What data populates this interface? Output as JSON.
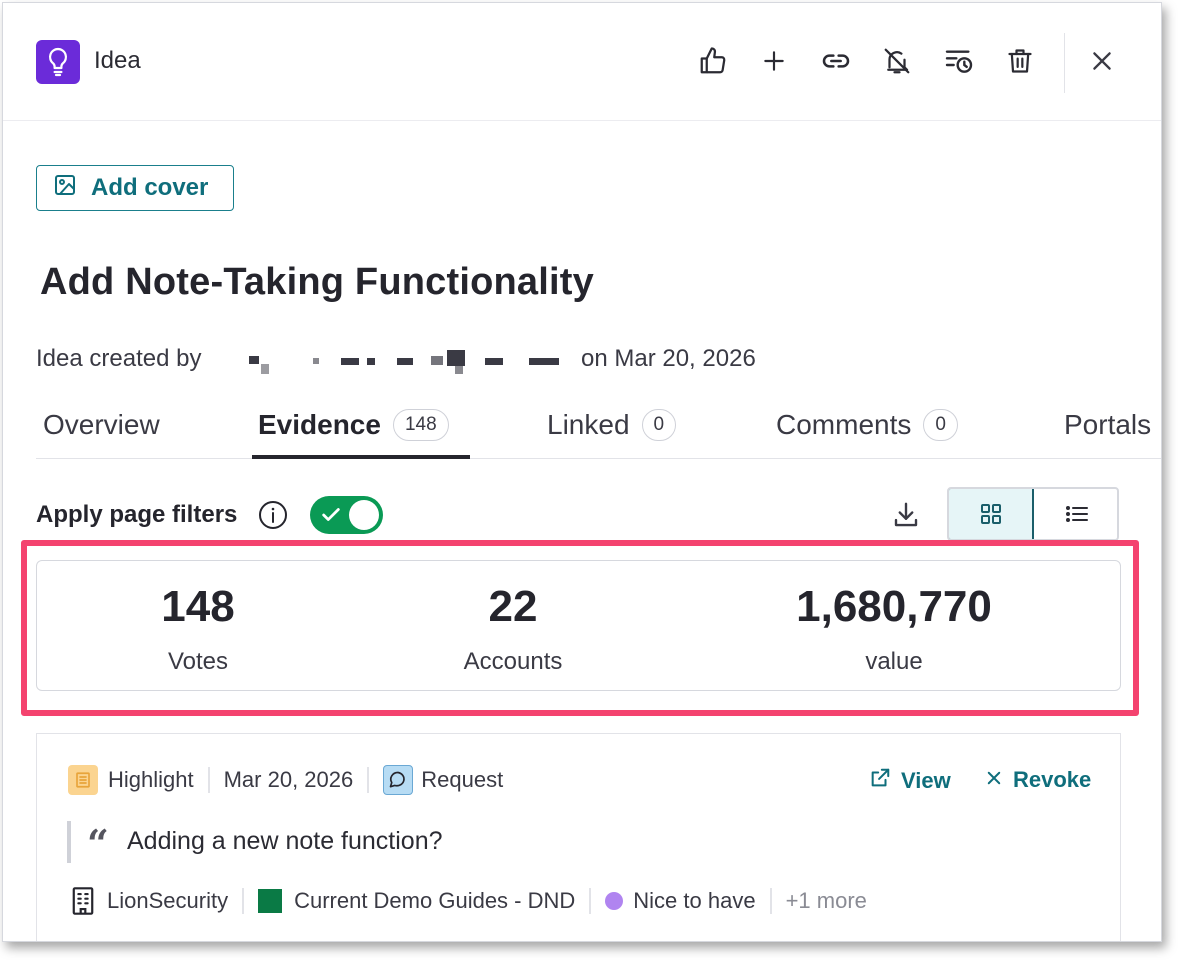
{
  "header": {
    "type_label": "Idea",
    "actions": [
      "thumbs-up-icon",
      "plus-icon",
      "link-icon",
      "bell-off-icon",
      "history-icon",
      "trash-icon",
      "close-icon"
    ]
  },
  "cover": {
    "label": "Add cover"
  },
  "idea": {
    "title": "Add Note-Taking Functionality",
    "created_prefix": "Idea created by",
    "created_suffix": "on Mar 20, 2026"
  },
  "tabs": [
    {
      "label": "Overview",
      "count": ""
    },
    {
      "label": "Evidence",
      "count": "148"
    },
    {
      "label": "Linked",
      "count": "0"
    },
    {
      "label": "Comments",
      "count": "0"
    },
    {
      "label": "Portals",
      "count": ""
    }
  ],
  "active_tab": "Evidence",
  "filters": {
    "label": "Apply page filters",
    "enabled": true
  },
  "stats": [
    {
      "value": "148",
      "label": "Votes"
    },
    {
      "value": "22",
      "label": "Accounts"
    },
    {
      "value": "1,680,770",
      "label": "value"
    }
  ],
  "evidence": {
    "type": "Highlight",
    "date": "Mar 20, 2026",
    "category": "Request",
    "view_label": "View",
    "revoke_label": "Revoke",
    "quote": "Adding a new note function?",
    "account": "LionSecurity",
    "guide": "Current Demo Guides - DND",
    "priority": "Nice to have",
    "more": "+1 more"
  },
  "colors": {
    "accent": "#0f6e7c",
    "idea_badge": "#6b2bd9",
    "toggle_on": "#0a9a55",
    "highlight_outline": "#f4436f"
  }
}
